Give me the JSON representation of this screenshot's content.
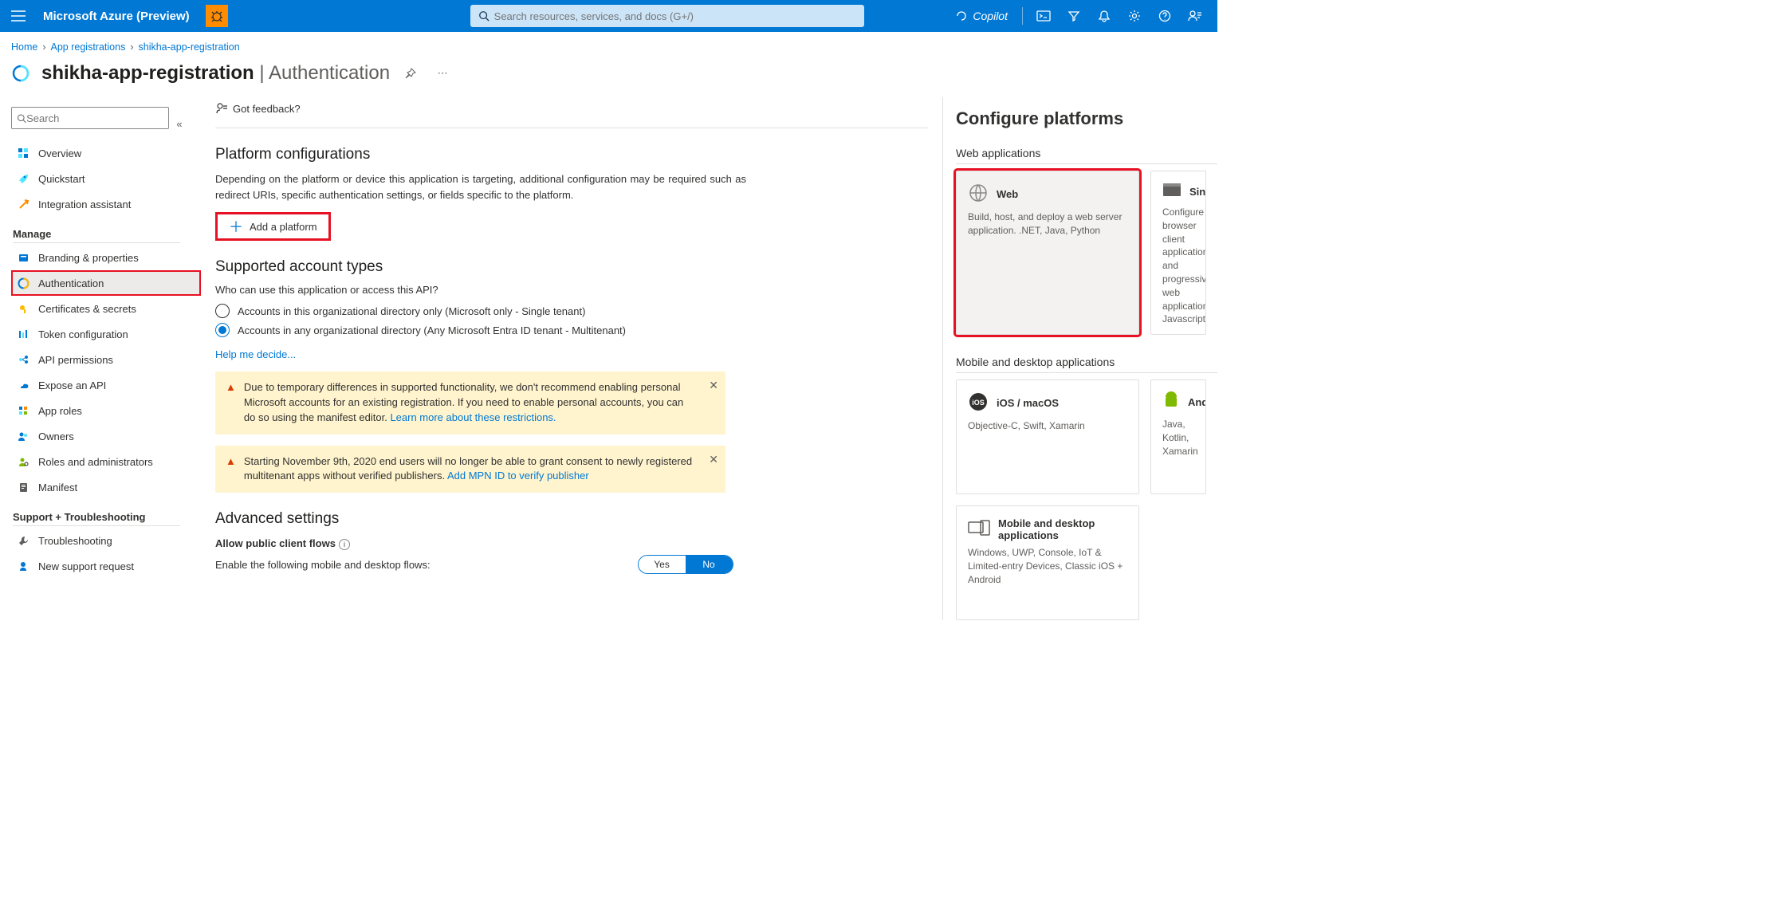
{
  "header": {
    "brand": "Microsoft Azure (Preview)",
    "search_placeholder": "Search resources, services, and docs (G+/)",
    "copilot": "Copilot"
  },
  "breadcrumb": {
    "items": [
      "Home",
      "App registrations",
      "shikha-app-registration"
    ]
  },
  "page_title": {
    "app_name": "shikha-app-registration",
    "section": "Authentication"
  },
  "sidebar": {
    "search_placeholder": "Search",
    "top": [
      {
        "label": "Overview"
      },
      {
        "label": "Quickstart"
      },
      {
        "label": "Integration assistant"
      }
    ],
    "groups": [
      {
        "name": "Manage",
        "items": [
          {
            "label": "Branding & properties"
          },
          {
            "label": "Authentication",
            "selected": true,
            "highlight": true
          },
          {
            "label": "Certificates & secrets"
          },
          {
            "label": "Token configuration"
          },
          {
            "label": "API permissions"
          },
          {
            "label": "Expose an API"
          },
          {
            "label": "App roles"
          },
          {
            "label": "Owners"
          },
          {
            "label": "Roles and administrators"
          },
          {
            "label": "Manifest"
          }
        ]
      },
      {
        "name": "Support + Troubleshooting",
        "items": [
          {
            "label": "Troubleshooting"
          },
          {
            "label": "New support request"
          }
        ]
      }
    ]
  },
  "toolbar": {
    "feedback": "Got feedback?"
  },
  "platform_cfg": {
    "heading": "Platform configurations",
    "desc": "Depending on the platform or device this application is targeting, additional configuration may be required such as redirect URIs, specific authentication settings, or fields specific to the platform.",
    "add_button": "Add a platform"
  },
  "supported_accounts": {
    "heading": "Supported account types",
    "question": "Who can use this application or access this API?",
    "options": [
      {
        "label": "Accounts in this organizational directory only (Microsoft only - Single tenant)",
        "selected": false
      },
      {
        "label": "Accounts in any organizational directory (Any Microsoft Entra ID tenant - Multitenant)",
        "selected": true
      }
    ],
    "help_link": "Help me decide..."
  },
  "alerts": {
    "a1": {
      "text": "Due to temporary differences in supported functionality, we don't recommend enabling personal Microsoft accounts for an existing registration. If you need to enable personal accounts, you can do so using the manifest editor. ",
      "link": "Learn more about these restrictions."
    },
    "a2": {
      "text": "Starting November 9th, 2020 end users will no longer be able to grant consent to newly registered multitenant apps without verified publishers. ",
      "link": "Add MPN ID to verify publisher"
    }
  },
  "advanced": {
    "heading": "Advanced settings",
    "sub": "Allow public client flows",
    "desc": "Enable the following mobile and desktop flows:",
    "toggle_yes": "Yes",
    "toggle_no": "No"
  },
  "blade": {
    "title": "Configure platforms",
    "web_section": "Web applications",
    "mobile_section": "Mobile and desktop applications",
    "cards": {
      "web": {
        "title": "Web",
        "desc": "Build, host, and deploy a web server application. .NET, Java, Python"
      },
      "spa": {
        "title": "Single",
        "desc": "Configure browser client applications and progressive web applications. Javascript."
      },
      "ios": {
        "title": "iOS / macOS",
        "desc": "Objective-C, Swift, Xamarin"
      },
      "android": {
        "title": "Android",
        "desc": "Java, Kotlin, Xamarin"
      },
      "desktop": {
        "title": "Mobile and desktop applications",
        "desc": "Windows, UWP, Console, IoT & Limited-entry Devices, Classic iOS + Android"
      }
    }
  }
}
